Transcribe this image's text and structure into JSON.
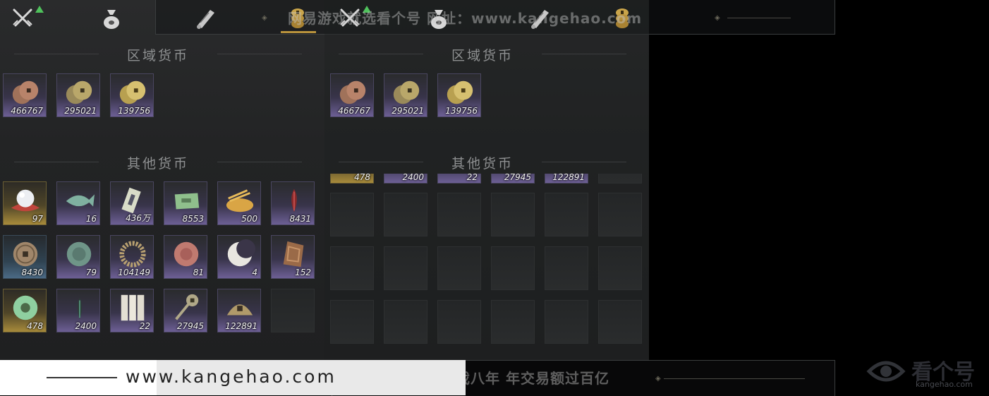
{
  "watermark": {
    "top": "网易游戏就选看个号  网址：www.kangehao.com",
    "bottom": "看个号专业网易游戏八年  年交易额过百亿",
    "url": "www.kangehao.com",
    "logo_text": "看个号",
    "logo_sub": "kangehao.com"
  },
  "tabs": [
    {
      "name": "weapons-tab",
      "icon": "crossed-swords-icon"
    },
    {
      "name": "pouch-tab",
      "icon": "money-pouch-icon"
    },
    {
      "name": "scroll-tab",
      "icon": "scroll-icon"
    },
    {
      "name": "currency-tab",
      "icon": "coin-stack-icon",
      "active": true
    }
  ],
  "left_panel": {
    "regional_title": "区域货币",
    "other_title": "其他货币",
    "regional": [
      {
        "count": "466767",
        "icon": "copper-coins-icon",
        "rarity": "purple"
      },
      {
        "count": "295021",
        "icon": "bronze-coins-icon",
        "rarity": "purple"
      },
      {
        "count": "139756",
        "icon": "gold-coins-icon",
        "rarity": "purple"
      }
    ],
    "other": [
      {
        "count": "97",
        "icon": "pearl-icon",
        "rarity": "gold"
      },
      {
        "count": "16",
        "icon": "jade-fish-icon",
        "rarity": "purple"
      },
      {
        "count": "436万",
        "icon": "banknote-icon",
        "rarity": "purple"
      },
      {
        "count": "8553",
        "icon": "green-ticket-icon",
        "rarity": "purple"
      },
      {
        "count": "500",
        "icon": "grain-pile-icon",
        "rarity": "purple"
      },
      {
        "count": "8431",
        "icon": "red-feather-icon",
        "rarity": "purple"
      },
      {
        "count": "8430",
        "icon": "ancient-coin-icon",
        "rarity": "blue"
      },
      {
        "count": "79",
        "icon": "jade-disc-icon",
        "rarity": "purple"
      },
      {
        "count": "104149",
        "icon": "bead-bracelet-icon",
        "rarity": "purple"
      },
      {
        "count": "81",
        "icon": "red-medallion-icon",
        "rarity": "purple"
      },
      {
        "count": "4",
        "icon": "crescent-moon-icon",
        "rarity": "purple"
      },
      {
        "count": "152",
        "icon": "bronze-plaque-icon",
        "rarity": "purple"
      },
      {
        "count": "478",
        "icon": "jade-ring-icon",
        "rarity": "gold"
      },
      {
        "count": "2400",
        "icon": "green-feather-icon",
        "rarity": "purple"
      },
      {
        "count": "22",
        "icon": "paper-slips-icon",
        "rarity": "purple"
      },
      {
        "count": "27945",
        "icon": "key-coin-icon",
        "rarity": "purple"
      },
      {
        "count": "122891",
        "icon": "half-coin-icon",
        "rarity": "purple"
      }
    ]
  },
  "right_panel": {
    "regional_title": "区域货币",
    "other_title": "其他货币",
    "regional": [
      {
        "count": "466767",
        "icon": "copper-coins-icon",
        "rarity": "purple"
      },
      {
        "count": "295021",
        "icon": "bronze-coins-icon",
        "rarity": "purple"
      },
      {
        "count": "139756",
        "icon": "gold-coins-icon",
        "rarity": "purple"
      }
    ],
    "scrolled_row": [
      {
        "count": "478",
        "rarity": "gold"
      },
      {
        "count": "2400",
        "rarity": "purple"
      },
      {
        "count": "22",
        "rarity": "purple"
      },
      {
        "count": "27945",
        "rarity": "purple"
      },
      {
        "count": "122891",
        "rarity": "purple"
      }
    ]
  },
  "colors": {
    "purple": "#6d5f95",
    "gold": "#a88b3b",
    "blue": "#4b6a85",
    "active_tab": "#b8923c"
  }
}
